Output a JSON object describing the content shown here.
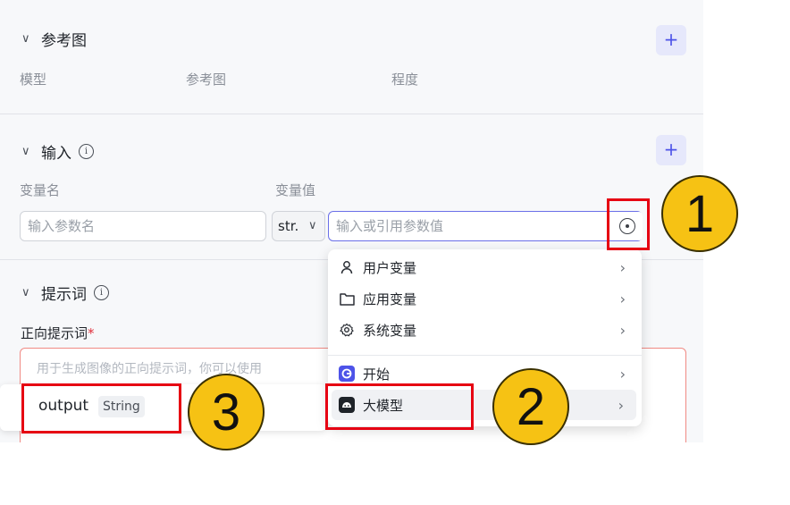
{
  "reference_section": {
    "title": "参考图",
    "columns": [
      "模型",
      "参考图",
      "程度"
    ],
    "add_button": "+"
  },
  "input_section": {
    "title": "输入",
    "info": "i",
    "columns": [
      "变量名",
      "变量值"
    ],
    "name_placeholder": "输入参数名",
    "type_value": "str.",
    "value_placeholder": "输入或引用参数值",
    "add_button": "+"
  },
  "prompt_section": {
    "title": "提示词",
    "info": "i",
    "positive_label": "正向提示词",
    "required_mark": "*",
    "positive_placeholder": "用于生成图像的正向提示词，你可以使用"
  },
  "variable_menu": {
    "items": [
      {
        "label": "用户变量",
        "icon": "user-icon"
      },
      {
        "label": "应用变量",
        "icon": "folder-icon"
      },
      {
        "label": "系统变量",
        "icon": "gear-icon"
      },
      {
        "label": "开始",
        "icon": "start-node-icon"
      },
      {
        "label": "大模型",
        "icon": "llm-node-icon"
      }
    ],
    "arrow": "›"
  },
  "output_card": {
    "name": "output",
    "type": "String"
  },
  "annotations": [
    "1",
    "2",
    "3"
  ],
  "colors": {
    "accent": "#4d53e8",
    "highlight_frame": "#e60012",
    "badge_fill": "#f6c214"
  }
}
